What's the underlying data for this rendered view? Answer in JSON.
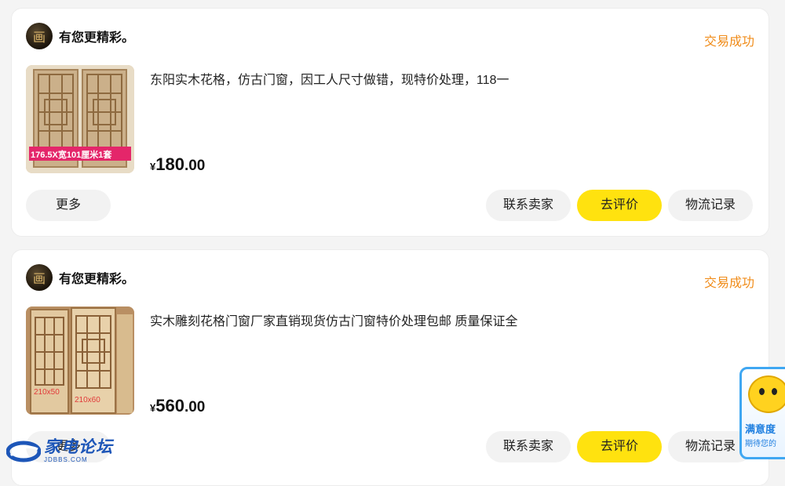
{
  "orders": [
    {
      "seller_name": "有您更精彩。",
      "avatar_glyph": "画",
      "status": "交易成功",
      "title": "东阳实木花格，仿古门窗，因工人尺寸做错，现特价处理，118一",
      "thumb_caption": "176.5X宽101厘米1套",
      "price_currency": "¥",
      "price_integer": "180",
      "price_decimal": ".00",
      "buttons": {
        "more": "更多",
        "contact": "联系卖家",
        "review": "去评价",
        "logistics": "物流记录"
      }
    },
    {
      "seller_name": "有您更精彩。",
      "avatar_glyph": "画",
      "status": "交易成功",
      "title": "实木雕刻花格门窗厂家直销现货仿古门窗特价处理包邮 质量保证全",
      "thumb_labels": [
        "210x50",
        "210x60"
      ],
      "price_currency": "¥",
      "price_integer": "560",
      "price_decimal": ".00",
      "buttons": {
        "more": "更多",
        "contact": "联系卖家",
        "review": "去评价",
        "logistics": "物流记录"
      }
    }
  ],
  "watermark": {
    "main": "家电论坛",
    "sub": "JDBBS.COM"
  },
  "floating_badge": {
    "line1": "满意度",
    "line2": "期待您的"
  },
  "colors": {
    "status": "#f08c1a",
    "review_button": "#ffe20f",
    "brand_blue": "#1d56b8"
  }
}
